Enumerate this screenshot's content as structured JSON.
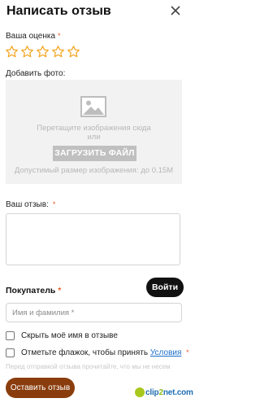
{
  "header": {
    "title": "Написать отзыв"
  },
  "rating": {
    "label": "Ваша оценка",
    "required_mark": "*",
    "value": 0,
    "max": 5,
    "star_color": "#f5a623"
  },
  "photo": {
    "label": "Добавить фото:",
    "drop_line1": "Перетащите изображения сюда",
    "drop_line2": "или",
    "upload_button": "ЗАГРУЗИТЬ ФАЙЛ",
    "size_hint": "Допустимый размер изображения: до 0.15М"
  },
  "review": {
    "label": "Ваш отзыв:",
    "required_mark": "*",
    "value": ""
  },
  "buyer": {
    "label": "Покупатель",
    "required_mark": "*",
    "login_button": "Войти",
    "name_placeholder": "Имя и фамилия *",
    "name_value": ""
  },
  "options": {
    "hide_name": {
      "label": "Скрыть моё имя в отзыве",
      "checked": false
    },
    "accept_terms": {
      "label_prefix": "Отметьте флажок, чтобы принять",
      "link": "Условия",
      "required_mark": "*",
      "checked": false
    },
    "faded_text": "Перед отправкой отзыва прочитайте, что мы не несем"
  },
  "footer": {
    "submit_button": "Оставить отзыв",
    "brand_color": "#8a3d0c",
    "watermark_a": "clip",
    "watermark_b": "2",
    "watermark_c": "net.com"
  }
}
